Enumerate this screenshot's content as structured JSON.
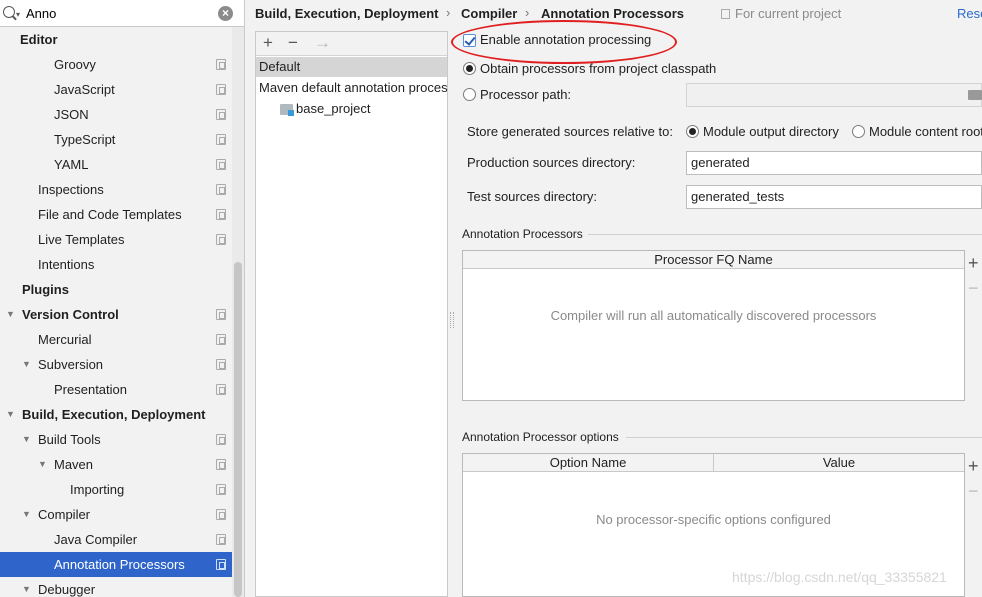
{
  "search": {
    "value": "Anno"
  },
  "sidebar": {
    "items": [
      {
        "label": "Editor",
        "indent": 20,
        "bold": true,
        "arrow": false,
        "copy": false
      },
      {
        "label": "Groovy",
        "indent": 54,
        "bold": false,
        "arrow": false,
        "copy": true
      },
      {
        "label": "JavaScript",
        "indent": 54,
        "bold": false,
        "arrow": false,
        "copy": true
      },
      {
        "label": "JSON",
        "indent": 54,
        "bold": false,
        "arrow": false,
        "copy": true
      },
      {
        "label": "TypeScript",
        "indent": 54,
        "bold": false,
        "arrow": false,
        "copy": true
      },
      {
        "label": "YAML",
        "indent": 54,
        "bold": false,
        "arrow": false,
        "copy": true
      },
      {
        "label": "Inspections",
        "indent": 38,
        "bold": false,
        "arrow": false,
        "copy": true
      },
      {
        "label": "File and Code Templates",
        "indent": 38,
        "bold": false,
        "arrow": false,
        "copy": true
      },
      {
        "label": "Live Templates",
        "indent": 38,
        "bold": false,
        "arrow": false,
        "copy": true
      },
      {
        "label": "Intentions",
        "indent": 38,
        "bold": false,
        "arrow": false,
        "copy": false
      },
      {
        "label": "Plugins",
        "indent": 22,
        "bold": true,
        "arrow": false,
        "copy": false
      },
      {
        "label": "Version Control",
        "indent": 22,
        "bold": true,
        "arrow": true,
        "copy": true
      },
      {
        "label": "Mercurial",
        "indent": 38,
        "bold": false,
        "arrow": false,
        "copy": true
      },
      {
        "label": "Subversion",
        "indent": 38,
        "bold": false,
        "arrow": true,
        "copy": true
      },
      {
        "label": "Presentation",
        "indent": 54,
        "bold": false,
        "arrow": false,
        "copy": true
      },
      {
        "label": "Build, Execution, Deployment",
        "indent": 22,
        "bold": true,
        "arrow": true,
        "copy": false
      },
      {
        "label": "Build Tools",
        "indent": 38,
        "bold": false,
        "arrow": true,
        "copy": true
      },
      {
        "label": "Maven",
        "indent": 54,
        "bold": false,
        "arrow": true,
        "copy": true
      },
      {
        "label": "Importing",
        "indent": 70,
        "bold": false,
        "arrow": false,
        "copy": true
      },
      {
        "label": "Compiler",
        "indent": 38,
        "bold": false,
        "arrow": true,
        "copy": true
      },
      {
        "label": "Java Compiler",
        "indent": 54,
        "bold": false,
        "arrow": false,
        "copy": true
      },
      {
        "label": "Annotation Processors",
        "indent": 54,
        "bold": false,
        "arrow": false,
        "copy": true,
        "selected": true
      },
      {
        "label": "Debugger",
        "indent": 38,
        "bold": false,
        "arrow": true,
        "copy": false
      }
    ]
  },
  "header": {
    "crumb1": "Build, Execution, Deployment",
    "crumb2": "Compiler",
    "crumb3": "Annotation Processors",
    "for_project": "For current project",
    "reset": "Rese"
  },
  "profiles": {
    "default": "Default",
    "maven": "Maven default annotation processors profile",
    "base": "base_project"
  },
  "settings": {
    "enable_label": "Enable annotation processing",
    "obtain_label": "Obtain processors from project classpath",
    "path_label": "Processor path:",
    "store_label": "Store generated sources relative to:",
    "module_output": "Module output directory",
    "module_content": "Module content root",
    "prod_label": "Production sources directory:",
    "prod_value": "generated",
    "test_label": "Test sources directory:",
    "test_value": "generated_tests"
  },
  "processors": {
    "title": "Annotation Processors",
    "column": "Processor FQ Name",
    "empty": "Compiler will run all automatically discovered processors"
  },
  "options": {
    "title": "Annotation Processor options",
    "col_name": "Option Name",
    "col_value": "Value",
    "empty": "No processor-specific options configured"
  },
  "watermark": "https://blog.csdn.net/qq_33355821",
  "colors": {
    "selection": "#2f65ca",
    "annotation_ellipse": "#e02020",
    "link": "#2a6bd1"
  }
}
